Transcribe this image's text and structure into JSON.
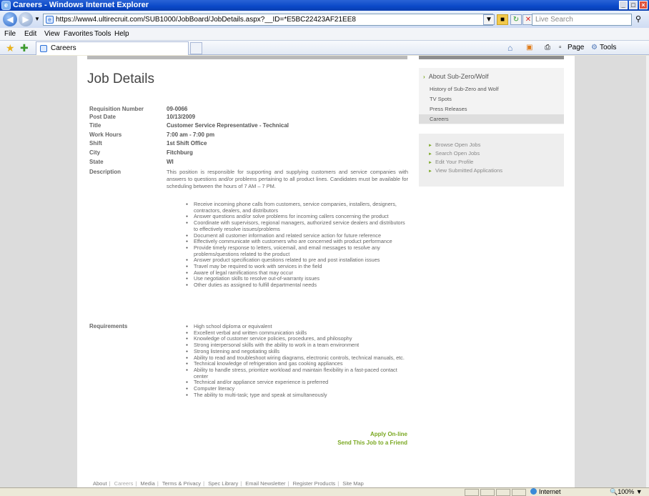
{
  "window": {
    "title": "Careers - Windows Internet Explorer",
    "min": "_",
    "max": "□",
    "close": "×"
  },
  "browser": {
    "back": "◀",
    "forward": "▶",
    "address": "https://www4.ultirecruit.com/SUB1000/JobBoard/JobDetails.aspx?__ID=*E5BC22423AF21EE8",
    "live_search_placeholder": "Live Search",
    "menu": [
      "File",
      "Edit",
      "View",
      "Favorites",
      "Tools",
      "Help"
    ],
    "tab_label": "Careers",
    "commands": {
      "page": "Page",
      "tools": "Tools"
    }
  },
  "job": {
    "heading": "Job Details",
    "fields": [
      {
        "label": "Requisition Number",
        "value": "09-0066"
      },
      {
        "label": "Post Date",
        "value": "10/13/2009"
      },
      {
        "label": "Title",
        "value": "Customer Service Representative - Technical"
      },
      {
        "label": "Work Hours",
        "value": "7:00 am - 7:00 pm"
      },
      {
        "label": "Shift",
        "value": "1st Shift Office"
      },
      {
        "label": "City",
        "value": "Fitchburg"
      },
      {
        "label": "State",
        "value": "WI"
      },
      {
        "label": "Description",
        "value": ""
      }
    ],
    "description": "This position is responsible for supporting and supplying customers and service companies with answers to questions and/or problems pertaining to all product lines. Candidates must be available for scheduling between the hours of 7 AM – 7 PM.",
    "duties": [
      "Receive incoming phone calls from customers, service companies, installers, designers, contractors, dealers, and distributors",
      "Answer questions and/or solve problems for incoming callers concerning the product",
      "Coordinate with supervisors, regional managers, authorized service dealers and distributors to effectively resolve issues/problems",
      "Document all customer information and related service action for future reference",
      "Effectively communicate with customers who are concerned with product performance",
      "Provide timely response to letters, voicemail, and email messages to resolve any problems/questions related to the product",
      "Answer product specification questions related to pre and post installation issues",
      "Travel may be required to work with services in the field",
      "Aware of legal ramifications that may occur",
      "Use negotiation skills to resolve out-of-warranty issues",
      "Other duties as assigned to fulfill departmental needs"
    ],
    "requirements_label": "Requirements",
    "requirements": [
      "High school diploma or equivalent",
      "Excellent verbal and written communication skills",
      "Knowledge of customer service policies, procedures, and philosophy",
      "Strong interpersonal skills with the ability to work in a team environment",
      "Strong listening and negotiating skills",
      "Ability to read and troubleshoot wiring diagrams, electronic controls, technical manuals, etc.",
      "Technical knowledge of refrigeration and gas cooking appliances",
      "Ability to handle stress, prioritize workload and maintain flexibility in a fast-paced contact center",
      "Technical and/or appliance service experience is preferred",
      "Computer literacy",
      "The ability to multi-task; type and speak at simultaneously"
    ],
    "apply_label": "Apply On-line",
    "send_label": "Send This Job to a Friend"
  },
  "sidebar": {
    "about_header": "About Sub-Zero/Wolf",
    "about_items": [
      "History of Sub-Zero and Wolf",
      "TV Spots",
      "Press Releases",
      "Careers"
    ],
    "job_links": [
      "Browse Open Jobs",
      "Search Open Jobs",
      "Edit Your Profile",
      "View Submitted Applications"
    ]
  },
  "footer": {
    "links": [
      "About",
      "Careers",
      "Media",
      "Terms & Privacy",
      "Spec Library",
      "Email Newsletter",
      "Register Products",
      "Site Map"
    ]
  },
  "status": {
    "zone": "Internet",
    "zoom": "100%"
  }
}
